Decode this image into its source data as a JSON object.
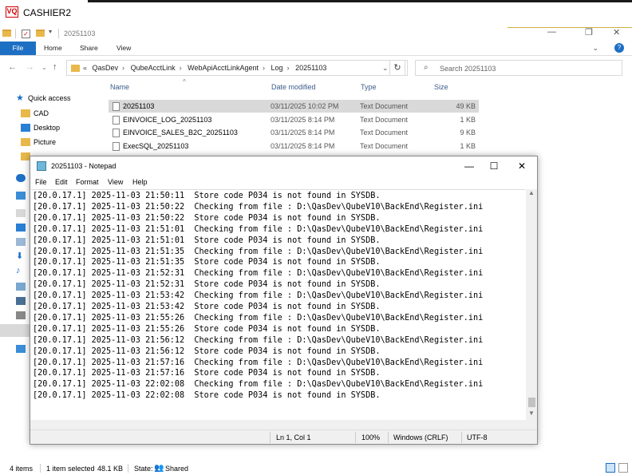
{
  "app": {
    "title": "CASHIER2",
    "logo_text": "VQ"
  },
  "explorer": {
    "qat_path": "20251103",
    "ribbon": {
      "tabs": [
        "File",
        "Home",
        "Share",
        "View"
      ]
    },
    "address": {
      "crumbs": [
        "QasDev",
        "QubeAcctLink",
        "WebApiAcctLinkAgent",
        "Log",
        "20251103"
      ],
      "search_placeholder": "Search 20251103"
    },
    "columns": [
      "Name",
      "Date modified",
      "Type",
      "Size"
    ],
    "files": [
      {
        "name": "20251103",
        "date": "03/11/2025 10:02 PM",
        "type": "Text Document",
        "size": "49 KB",
        "selected": true
      },
      {
        "name": "EINVOICE_LOG_20251103",
        "date": "03/11/2025 8:14 PM",
        "type": "Text Document",
        "size": "1 KB",
        "selected": false
      },
      {
        "name": "EINVOICE_SALES_B2C_20251103",
        "date": "03/11/2025 8:14 PM",
        "type": "Text Document",
        "size": "9 KB",
        "selected": false
      },
      {
        "name": "ExecSQL_20251103",
        "date": "03/11/2025 8:14 PM",
        "type": "Text Document",
        "size": "1 KB",
        "selected": false
      }
    ],
    "nav": {
      "quick_access": "Quick access",
      "items": [
        "CAD",
        "Desktop",
        "Picture"
      ]
    },
    "status": {
      "items": "4 items",
      "selected": "1 item selected",
      "size": "48.1 KB",
      "state_label": "State:",
      "state_value": "Shared"
    }
  },
  "notepad": {
    "title": "20251103 - Notepad",
    "menu": [
      "File",
      "Edit",
      "Format",
      "View",
      "Help"
    ],
    "lines": [
      "[20.0.17.1] 2025-11-03 21:50:11  Store code P034 is not found in SYSDB.",
      "[20.0.17.1] 2025-11-03 21:50:22  Checking from file : D:\\QasDev\\QubeV10\\BackEnd\\Register.ini",
      "[20.0.17.1] 2025-11-03 21:50:22  Store code P034 is not found in SYSDB.",
      "[20.0.17.1] 2025-11-03 21:51:01  Checking from file : D:\\QasDev\\QubeV10\\BackEnd\\Register.ini",
      "[20.0.17.1] 2025-11-03 21:51:01  Store code P034 is not found in SYSDB.",
      "[20.0.17.1] 2025-11-03 21:51:35  Checking from file : D:\\QasDev\\QubeV10\\BackEnd\\Register.ini",
      "[20.0.17.1] 2025-11-03 21:51:35  Store code P034 is not found in SYSDB.",
      "[20.0.17.1] 2025-11-03 21:52:31  Checking from file : D:\\QasDev\\QubeV10\\BackEnd\\Register.ini",
      "[20.0.17.1] 2025-11-03 21:52:31  Store code P034 is not found in SYSDB.",
      "[20.0.17.1] 2025-11-03 21:53:42  Checking from file : D:\\QasDev\\QubeV10\\BackEnd\\Register.ini",
      "[20.0.17.1] 2025-11-03 21:53:42  Store code P034 is not found in SYSDB.",
      "[20.0.17.1] 2025-11-03 21:55:26  Checking from file : D:\\QasDev\\QubeV10\\BackEnd\\Register.ini",
      "[20.0.17.1] 2025-11-03 21:55:26  Store code P034 is not found in SYSDB.",
      "[20.0.17.1] 2025-11-03 21:56:12  Checking from file : D:\\QasDev\\QubeV10\\BackEnd\\Register.ini",
      "[20.0.17.1] 2025-11-03 21:56:12  Store code P034 is not found in SYSDB.",
      "[20.0.17.1] 2025-11-03 21:57:16  Checking from file : D:\\QasDev\\QubeV10\\BackEnd\\Register.ini",
      "[20.0.17.1] 2025-11-03 21:57:16  Store code P034 is not found in SYSDB.",
      "[20.0.17.1] 2025-11-03 22:02:08  Checking from file : D:\\QasDev\\QubeV10\\BackEnd\\Register.ini",
      "[20.0.17.1] 2025-11-03 22:02:08  Store code P034 is not found in SYSDB."
    ],
    "status": {
      "position": "Ln 1, Col 1",
      "zoom": "100%",
      "line_ending": "Windows (CRLF)",
      "encoding": "UTF-8"
    }
  },
  "colors": {
    "accent": "#1d6fc4",
    "selection": "#d9d9d9",
    "folder": "#e8b84a"
  }
}
